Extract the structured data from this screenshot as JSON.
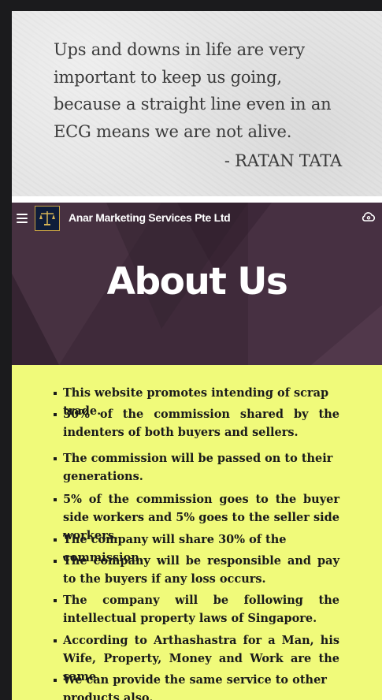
{
  "quote": {
    "text": "Ups and downs in life are very\nimportant to keep us going,\nbecause a straight line even in an\nECG means we are not alive.",
    "author": "- RATAN TATA"
  },
  "header": {
    "brand": "Anar Marketing Services Pte Ltd",
    "menu_icon": "hamburger-icon",
    "account_icon": "cloud-icon"
  },
  "hero": {
    "title": "About Us"
  },
  "about": {
    "items": [
      "This website promotes intending of scrap trade.",
      "30% of the commission shared by the indenters of both buyers and sellers.",
      "The commission will be passed on to their generations.",
      "5% of the commission goes to the buyer side workers and 5% goes to the seller side workers.",
      "The company will share 30% of the commission.",
      "The company will be responsible and pay to the buyers if any loss occurs.",
      "The company will be following the intellectual property laws of Singapore.",
      "According to Arthashastra for a Man, his Wife, Property, Money and Work are the same.",
      "We can provide the same service to other products also."
    ]
  },
  "colors": {
    "hero_bg": "#3f2a3a",
    "content_bg": "#f0fa7a",
    "text": "#1a1a1a"
  }
}
